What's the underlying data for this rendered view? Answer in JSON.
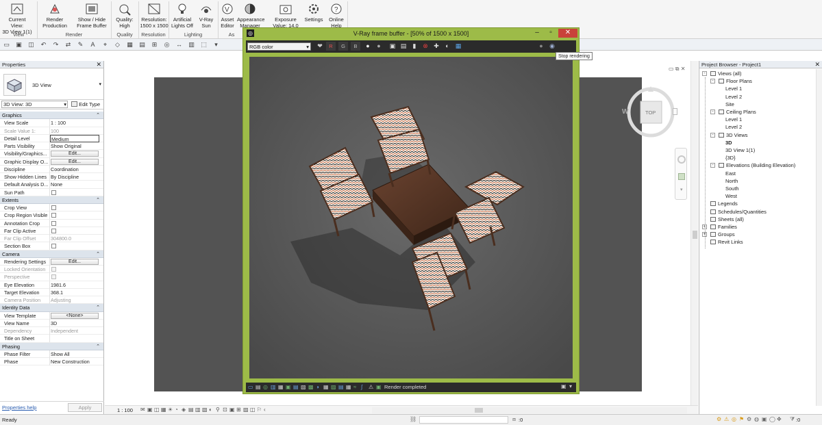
{
  "ribbon": {
    "buttons": [
      {
        "id": "current-view",
        "l1": "Current View:",
        "l2": "3D View 1(1)"
      },
      {
        "id": "render-production",
        "l1": "Render",
        "l2": "Production"
      },
      {
        "id": "show-hide-frame-buffer",
        "l1": "Show / Hide",
        "l2": "Frame Buffer"
      },
      {
        "id": "quality",
        "l1": "Quality:",
        "l2": "High"
      },
      {
        "id": "resolution",
        "l1": "Resolution:",
        "l2": "1500 x 1500"
      },
      {
        "id": "artificial-lights",
        "l1": "Artificial",
        "l2": "Lights Off"
      },
      {
        "id": "vray-sun",
        "l1": "V-Ray",
        "l2": "Sun"
      },
      {
        "id": "asset-editor",
        "l1": "Asset",
        "l2": "Editor"
      },
      {
        "id": "appearance-manager",
        "l1": "Appearance",
        "l2": "Manager"
      },
      {
        "id": "exposure",
        "l1": "Exposure",
        "l2": "Value: 14.0"
      },
      {
        "id": "settings",
        "l1": "Settings",
        "l2": ""
      },
      {
        "id": "online-help",
        "l1": "Online",
        "l2": "Help"
      }
    ],
    "groups": [
      "View",
      "Render",
      "Quality",
      "Resolution",
      "Lighting",
      "As"
    ]
  },
  "vfb": {
    "title": "V-Ray frame buffer - [50% of 1500 x 1500]",
    "channel": "RGB color",
    "channel_buttons": [
      "R",
      "G",
      "B"
    ],
    "tooltip": "Stop rendering",
    "status": "Render completed"
  },
  "properties": {
    "title": "Properties",
    "type_name": "3D View",
    "view_selector": "3D View: 3D",
    "edit_type": "Edit Type",
    "rows": [
      {
        "t": "hdr",
        "k": "Graphics"
      },
      {
        "k": "View Scale",
        "v": "1 : 100"
      },
      {
        "k": "Scale Value    1:",
        "v": "100",
        "g": true
      },
      {
        "k": "Detail Level",
        "v": "Medium",
        "boxed": true
      },
      {
        "k": "Parts Visibility",
        "v": "Show Original"
      },
      {
        "k": "Visibility/Graphics...",
        "btn": "Edit..."
      },
      {
        "k": "Graphic Display O...",
        "btn": "Edit..."
      },
      {
        "k": "Discipline",
        "v": "Coordination"
      },
      {
        "k": "Show Hidden Lines",
        "v": "By Discipline"
      },
      {
        "k": "Default Analysis D...",
        "v": "None"
      },
      {
        "k": "Sun Path",
        "chk": true
      },
      {
        "t": "hdr",
        "k": "Extents"
      },
      {
        "k": "Crop View",
        "chk": true
      },
      {
        "k": "Crop Region Visible",
        "chk": true
      },
      {
        "k": "Annotation Crop",
        "chk": true
      },
      {
        "k": "Far Clip Active",
        "chk": true
      },
      {
        "k": "Far Clip Offset",
        "v": "304800.0",
        "g": true
      },
      {
        "k": "Section Box",
        "chk": true
      },
      {
        "t": "hdr",
        "k": "Camera"
      },
      {
        "k": "Rendering Settings",
        "btn": "Edit..."
      },
      {
        "k": "Locked Orientation",
        "chk": true,
        "g": true
      },
      {
        "k": "Perspective",
        "chk": true,
        "g": true
      },
      {
        "k": "Eye Elevation",
        "v": "1981.6"
      },
      {
        "k": "Target Elevation",
        "v": "368.1"
      },
      {
        "k": "Camera Position",
        "v": "Adjusting",
        "g": true
      },
      {
        "t": "hdr",
        "k": "Identity Data"
      },
      {
        "k": "View Template",
        "btn": "<None>"
      },
      {
        "k": "View Name",
        "v": "3D"
      },
      {
        "k": "Dependency",
        "v": "Independent",
        "g": true
      },
      {
        "k": "Title on Sheet",
        "v": ""
      },
      {
        "t": "hdr",
        "k": "Phasing"
      },
      {
        "k": "Phase Filter",
        "v": "Show All"
      },
      {
        "k": "Phase",
        "v": "New Construction"
      }
    ],
    "help_link": "Properties help",
    "apply": "Apply"
  },
  "browser": {
    "title": "Project Browser - Project1",
    "items": [
      {
        "d": 0,
        "label": "Views (all)",
        "exp": "-"
      },
      {
        "d": 1,
        "label": "Floor Plans",
        "exp": "-"
      },
      {
        "d": 2,
        "label": "Level 1"
      },
      {
        "d": 2,
        "label": "Level 2"
      },
      {
        "d": 2,
        "label": "Site"
      },
      {
        "d": 1,
        "label": "Ceiling Plans",
        "exp": "-"
      },
      {
        "d": 2,
        "label": "Level 1"
      },
      {
        "d": 2,
        "label": "Level 2"
      },
      {
        "d": 1,
        "label": "3D Views",
        "exp": "-"
      },
      {
        "d": 2,
        "label": "3D",
        "bold": true
      },
      {
        "d": 2,
        "label": "3D View 1(1)"
      },
      {
        "d": 2,
        "label": "{3D}"
      },
      {
        "d": 1,
        "label": "Elevations (Building Elevation)",
        "exp": "-"
      },
      {
        "d": 2,
        "label": "East"
      },
      {
        "d": 2,
        "label": "North"
      },
      {
        "d": 2,
        "label": "South"
      },
      {
        "d": 2,
        "label": "West"
      },
      {
        "d": 0,
        "label": "Legends"
      },
      {
        "d": 0,
        "label": "Schedules/Quantities"
      },
      {
        "d": 0,
        "label": "Sheets (all)"
      },
      {
        "d": 0,
        "label": "Families",
        "exp": "+"
      },
      {
        "d": 0,
        "label": "Groups",
        "exp": "+"
      },
      {
        "d": 0,
        "label": "Revit Links"
      }
    ]
  },
  "viewcube": {
    "face": "TOP",
    "west": "W"
  },
  "view_control": {
    "scale": "1 : 100"
  },
  "status": {
    "text": "Ready",
    "zero1": ":0",
    "zero2": ":0"
  }
}
